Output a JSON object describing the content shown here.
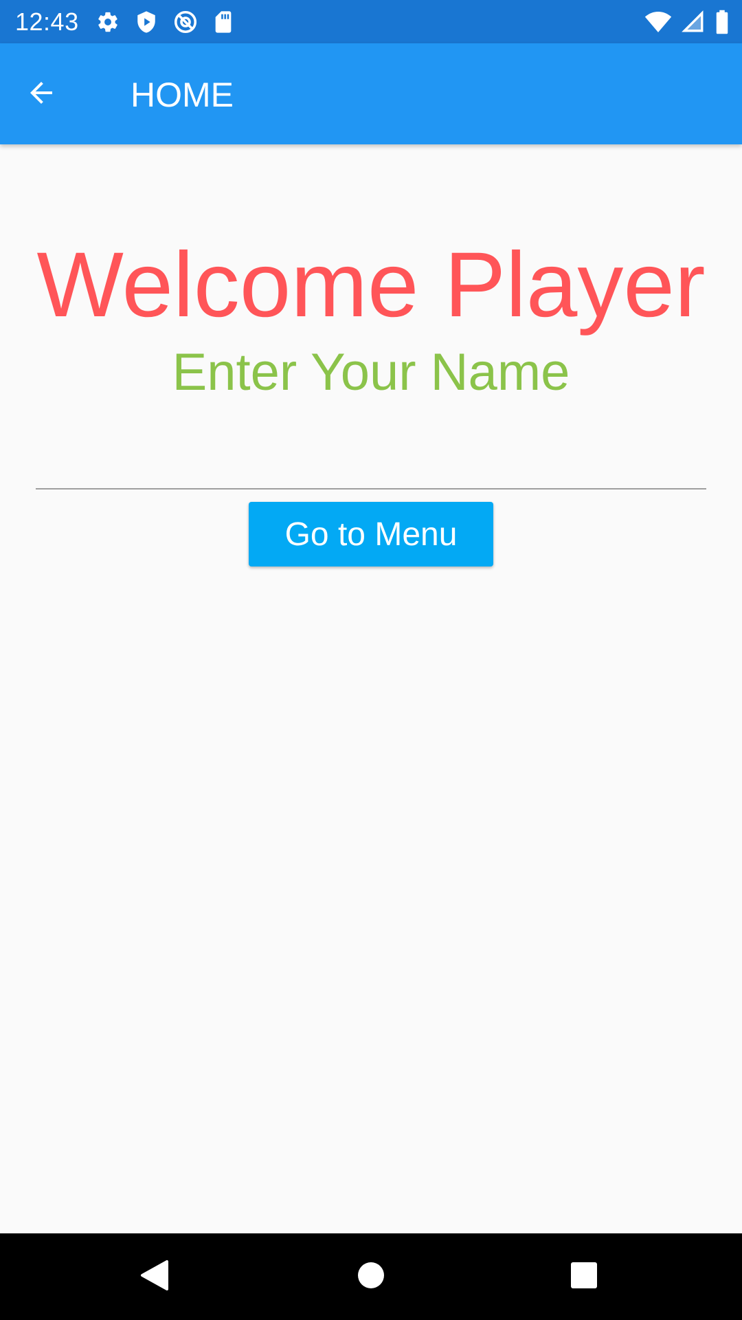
{
  "status_bar": {
    "time": "12:43",
    "icons_left": [
      "settings-icon",
      "shield-play-icon",
      "at-sign-icon",
      "sd-card-icon"
    ],
    "icons_right": [
      "wifi-icon",
      "cell-signal-icon",
      "battery-icon"
    ]
  },
  "app_bar": {
    "title": "HOME",
    "back_icon": "arrow-back-icon"
  },
  "content": {
    "welcome": "Welcome Player",
    "subtitle": "Enter Your Name",
    "name_input_value": "",
    "button_label": "Go to Menu"
  },
  "nav_bar": {
    "buttons": [
      "nav-back-icon",
      "nav-home-icon",
      "nav-recents-icon"
    ]
  },
  "colors": {
    "status_bar": "#1976d2",
    "app_bar": "#2196f3",
    "welcome_text": "#ff5558",
    "subtitle_text": "#8bc34a",
    "button": "#03a9f4",
    "background": "#fafafa"
  }
}
